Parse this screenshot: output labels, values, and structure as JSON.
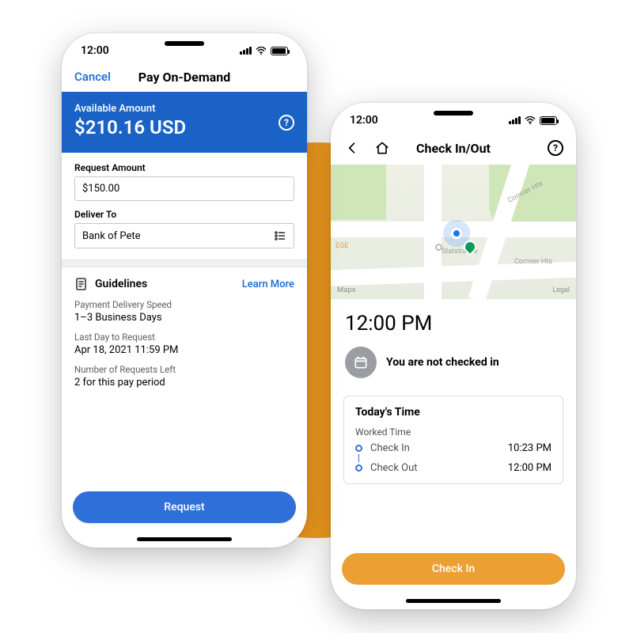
{
  "phone_left": {
    "status_time": "12:00",
    "nav": {
      "cancel": "Cancel",
      "title": "Pay On-Demand"
    },
    "banner": {
      "label": "Available Amount",
      "amount": "$210.16 USD"
    },
    "request_amount": {
      "label": "Request Amount",
      "value": "$150.00"
    },
    "deliver_to": {
      "label": "Deliver To",
      "value": "Bank of Pete"
    },
    "guidelines": {
      "title": "Guidelines",
      "learn_more": "Learn More",
      "rows": [
        {
          "k": "Payment Delivery Speed",
          "v": "1–3 Business Days"
        },
        {
          "k": "Last Day to Request",
          "v": "Apr 18, 2021 11:59 PM"
        },
        {
          "k": "Number of Requests Left",
          "v": "2 for this pay period"
        }
      ]
    },
    "request_button": "Request"
  },
  "phone_right": {
    "status_time": "12:00",
    "nav_title": "Check In/Out",
    "map": {
      "provider": "Maps",
      "legal": "Legal",
      "street1": "Cormier Hts",
      "street2": "Cormier Hts",
      "poi": "Statstrasse",
      "poi2": "EGE"
    },
    "big_time": "12:00 PM",
    "status_text": "You are not checked in",
    "card": {
      "title": "Today's Time",
      "subtitle": "Worked Time",
      "rows": [
        {
          "label": "Check In",
          "time": "10:23 PM"
        },
        {
          "label": "Check Out",
          "time": "12:00 PM"
        }
      ]
    },
    "checkin_button": "Check In"
  }
}
